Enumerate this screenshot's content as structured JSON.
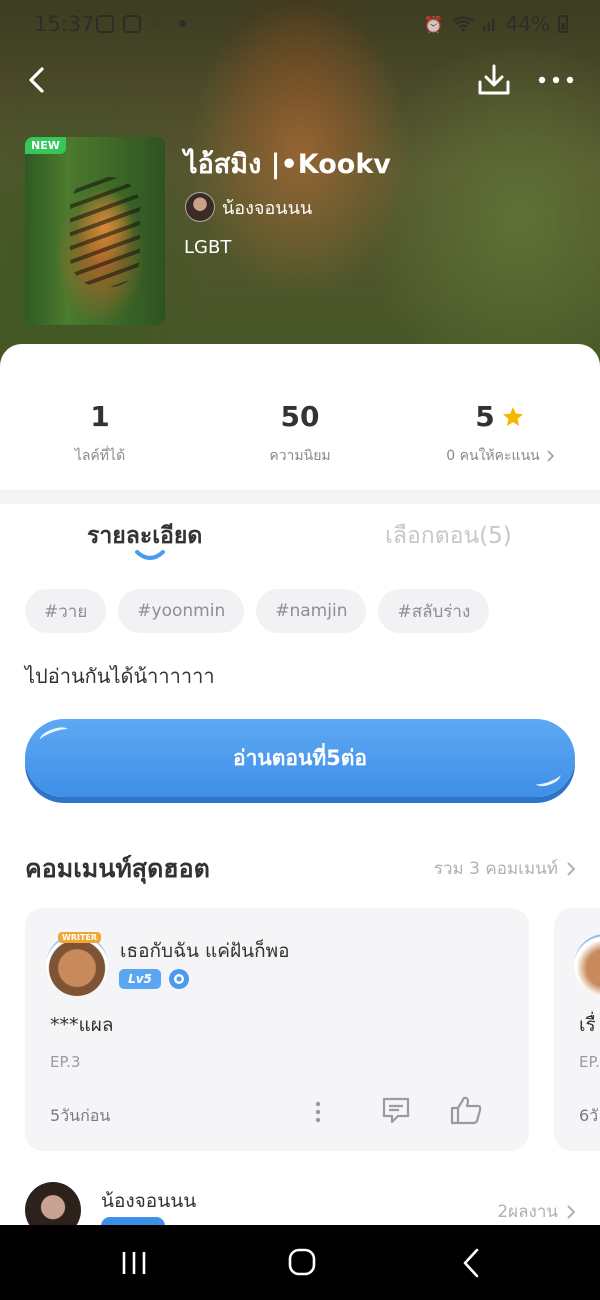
{
  "status_bar": {
    "time": "15:37",
    "battery": "44%"
  },
  "story": {
    "cover_badge": "NEW",
    "title": "ไอ้สมิง |•Kookv",
    "author": "น้องจอนนน",
    "genre": "LGBT"
  },
  "stats": {
    "likes_value": "1",
    "likes_label": "ไลค์ที่ได้",
    "popularity_value": "50",
    "popularity_label": "ความนิยม",
    "rating_value": "5",
    "rating_label": "0 คนให้คะแนน"
  },
  "tabs": {
    "details": "รายละเอียด",
    "episodes": "เลือกตอน(5)"
  },
  "tags": [
    "#วาย",
    "#yoonmin",
    "#namjin",
    "#สลับร่าง"
  ],
  "description": "ไปอ่านกันได้น้าาาาาา",
  "read_button": "อ่านตอนที่5ต่อ",
  "comments": {
    "title": "คอมเมนท์สุดฮอต",
    "total": "รวม 3 คอมเมนท์",
    "items": [
      {
        "writer_tag": "WRITER",
        "name": "เธอกับฉัน แค่ฝันก็พอ",
        "level": "Lv5",
        "text": "***แผล",
        "episode": "EP.3",
        "time": "5วันก่อน"
      },
      {
        "text": "เรื่",
        "episode": "EP.",
        "time": "6วั"
      }
    ]
  },
  "author_section": {
    "name": "น้องจอนนน",
    "works": "2ผลงาน"
  },
  "colors": {
    "accent_blue": "#4A9BEF",
    "star": "#F5B800",
    "new_badge": "#35C759"
  }
}
